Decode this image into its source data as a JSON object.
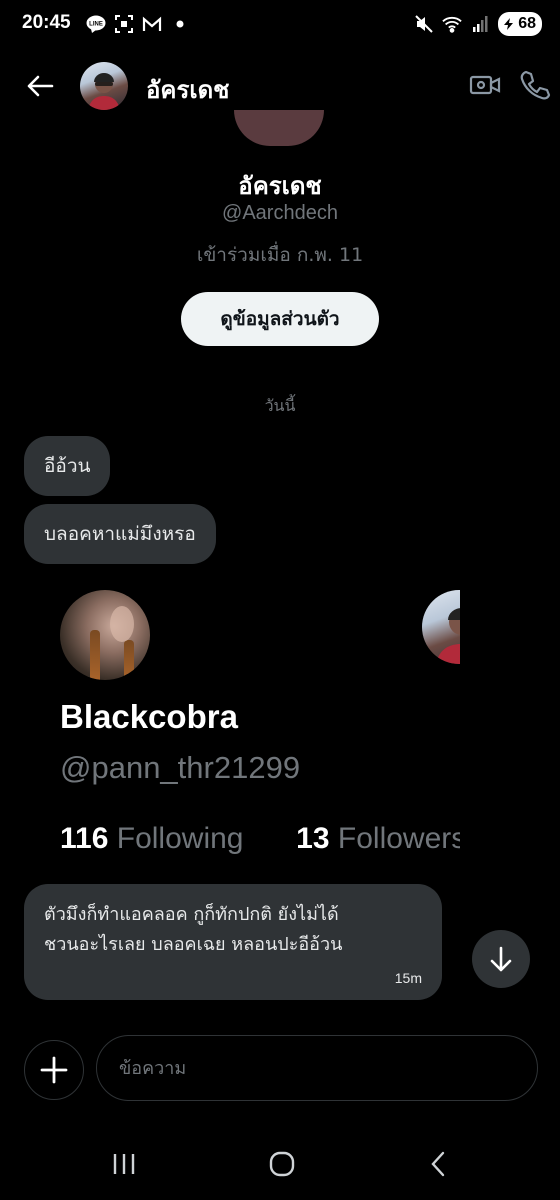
{
  "status_bar": {
    "time": "20:45",
    "battery": "68",
    "icons": [
      "line-icon",
      "screenshot-icon",
      "gmail-icon",
      "dot-icon",
      "mute-icon",
      "wifi-icon",
      "signal-icon",
      "battery-icon"
    ]
  },
  "header": {
    "name": "อัครเดช",
    "icons": [
      "back-arrow-icon",
      "video-call-icon",
      "phone-icon"
    ]
  },
  "profile": {
    "name": "อัครเดช",
    "handle": "@Aarchdech",
    "joined": "เข้าร่วมเมื่อ ก.พ. 11",
    "button_label": "ดูข้อมูลส่วนตัว"
  },
  "conversation": {
    "date_divider": "วันนี้",
    "messages": [
      {
        "text": "อีอ้วน"
      },
      {
        "text": "บลอคหาแม่มึงหรอ"
      },
      {
        "lines": [
          "ตัวมึงก็ทำแอคลอค กูก็ทักปกติ ยังไม่ได้",
          "ชวนอะไรเลย บลอคเฉย หลอนปะอีอ้วน"
        ],
        "time": "15m"
      }
    ]
  },
  "shared_card": {
    "name": "Blackcobra",
    "handle": "@pann_thr21299",
    "following_count": "116",
    "following_label": "Following",
    "followers_count": "13",
    "followers_label": "Followers"
  },
  "composer": {
    "placeholder": "ข้อความ",
    "value": ""
  },
  "colors": {
    "background": "#000000",
    "bubble": "#2f3336",
    "muted_text": "#71767b",
    "button_bg": "#eff3f4"
  }
}
